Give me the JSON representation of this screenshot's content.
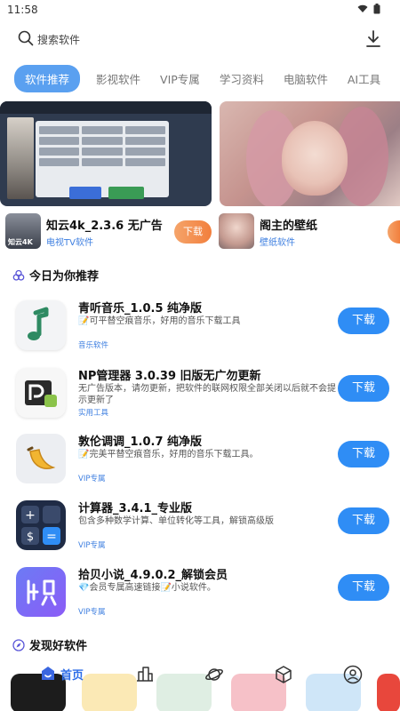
{
  "status_bar": {
    "time": "11:58"
  },
  "search": {
    "placeholder": "搜索软件"
  },
  "tabs": [
    "软件推荐",
    "影视软件",
    "VIP专属",
    "学习资料",
    "电脑软件",
    "AI工具"
  ],
  "featured": [
    {
      "title": "知云4k_2.3.6 无广告",
      "category": "电视TV软件",
      "button": "下载",
      "thumb_label": "知云4K"
    },
    {
      "title": "阁主的壁纸",
      "category": "壁纸软件"
    }
  ],
  "today_section": {
    "title": "今日为你推荐"
  },
  "apps": [
    {
      "title": "青听音乐_1.0.5 纯净版",
      "desc": "📝可平替空痕音乐，好用的音乐下载工具",
      "category": "音乐软件",
      "button": "下载"
    },
    {
      "title": "NP管理器 3.0.39 旧版无广勿更新",
      "desc": "无广告版本，请勿更新，把软件的联网权限全部关闭以后就不会提示更新了",
      "category": "实用工具",
      "button": "下载"
    },
    {
      "title": "敦伦调调_1.0.7 纯净版",
      "desc": "📝完美平替空痕音乐，好用的音乐下载工具。",
      "category": "VIP专属",
      "button": "下载"
    },
    {
      "title": "计算器_3.4.1_专业版",
      "desc": "包含多种数学计算、单位转化等工具，解锁高级版",
      "category": "VIP专属",
      "button": "下载"
    },
    {
      "title": "拾贝小说_4.9.0.2_解锁会员",
      "desc": "💎会员专属高速链接📝小说软件。",
      "category": "VIP专属",
      "button": "下载"
    }
  ],
  "discover_section": {
    "title": "发现好软件"
  },
  "bottom_nav": {
    "home_label": "首页"
  },
  "colors": {
    "accent": "#2f8df5",
    "tab_active": "#5aa0f0",
    "category_text": "#3e7fe0",
    "orange": "#f27f3d"
  }
}
